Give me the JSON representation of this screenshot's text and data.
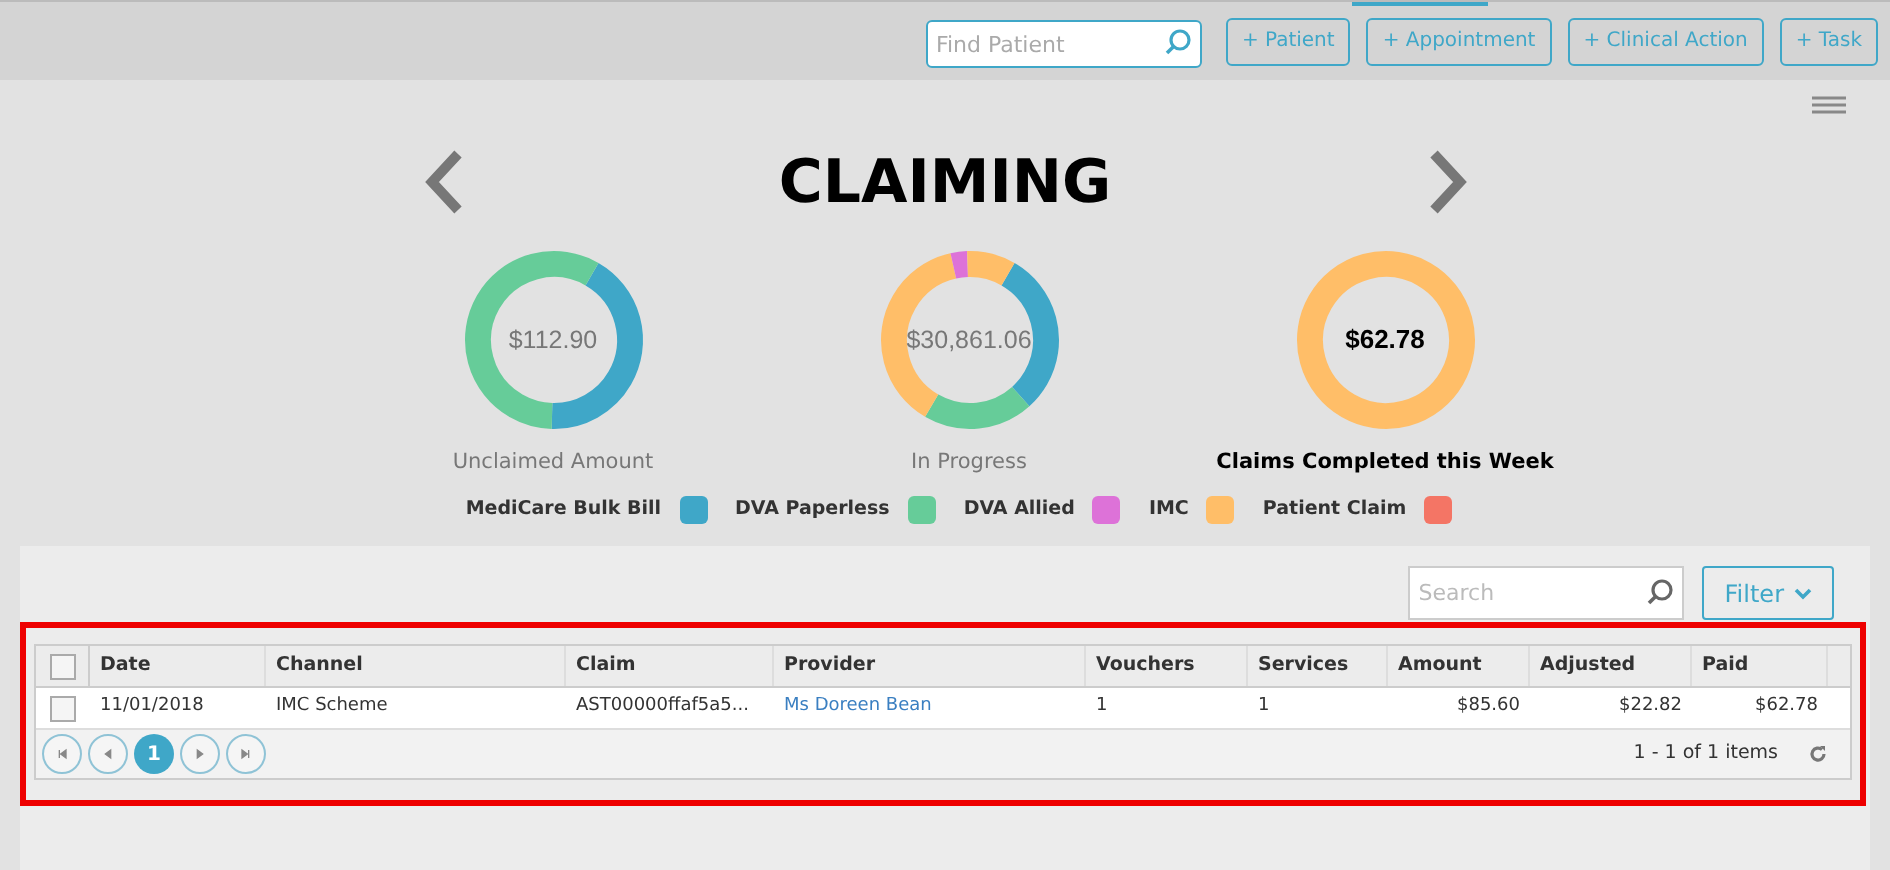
{
  "topbar": {
    "search": {
      "placeholder": "Find Patient"
    },
    "buttons": [
      "+ Patient",
      "+ Appointment",
      "+ Clinical Action",
      "+ Task"
    ]
  },
  "title": "CLAIMING",
  "summaries": [
    {
      "amount": "$112.90",
      "label": "Unclaimed Amount",
      "emphasis": false
    },
    {
      "amount": "$30,861.06",
      "label": "In Progress",
      "emphasis": false
    },
    {
      "amount": "$62.78",
      "label": "Claims Completed this Week",
      "emphasis": true
    }
  ],
  "legend": [
    {
      "label": "MediCare Bulk Bill",
      "color": "#3fa7c8"
    },
    {
      "label": "DVA Paperless",
      "color": "#66cc99"
    },
    {
      "label": "DVA Allied",
      "color": "#dd72d8"
    },
    {
      "label": "IMC",
      "color": "#ffbe68"
    },
    {
      "label": "Patient Claim",
      "color": "#f47565"
    }
  ],
  "table_search": {
    "placeholder": "Search"
  },
  "filter_button": "Filter",
  "table": {
    "all_checked": false,
    "columns": [
      "Date",
      "Channel",
      "Claim",
      "Provider",
      "Vouchers",
      "Services",
      "Amount",
      "Adjusted",
      "Paid"
    ],
    "rows": [
      {
        "checked": false,
        "cells": [
          "11/01/2018",
          "IMC Scheme",
          "AST00000ffaf5a5...",
          "Ms Doreen Bean",
          "1",
          "1",
          "$85.60",
          "$22.82",
          "$62.78"
        ]
      }
    ]
  },
  "pager": {
    "pages": [
      {
        "label": "1",
        "selected": true
      }
    ],
    "summary": "1 - 1 of 1 items"
  }
}
